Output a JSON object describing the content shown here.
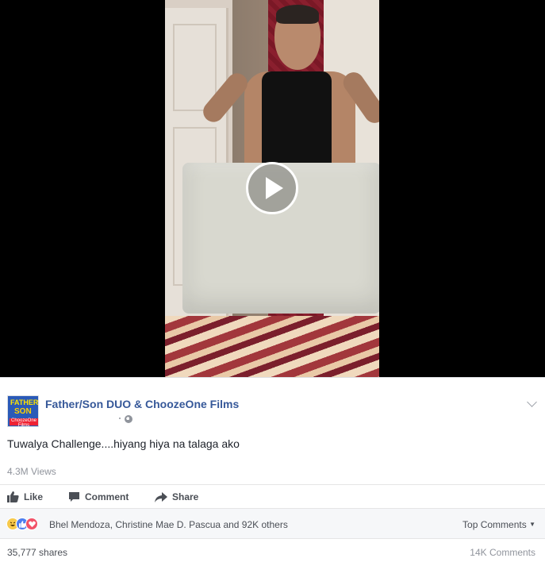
{
  "video": {
    "play_icon": "play-icon"
  },
  "post": {
    "page_name": "Father/Son DUO & ChoozeOne Films",
    "logo_text_top": "FATHER",
    "logo_text_mid": "SON",
    "logo_text_bottom": "ChoozeOne Films",
    "privacy_icon": "globe-icon",
    "text": "Tuwalya Challenge....hiyang hiya na talaga ako",
    "views": "4.3M Views"
  },
  "actions": {
    "like_label": "Like",
    "comment_label": "Comment",
    "share_label": "Share"
  },
  "reactions": {
    "icons": [
      "haha-icon",
      "like-icon",
      "love-icon"
    ],
    "names": "Bhel Mendoza, Christine Mae D. Pascua and 92K others",
    "sort_label": "Top Comments"
  },
  "footer": {
    "shares": "35,777 shares",
    "comments": "14K Comments"
  },
  "colors": {
    "link": "#365899",
    "meta": "#90949c",
    "action": "#4b4f56"
  }
}
